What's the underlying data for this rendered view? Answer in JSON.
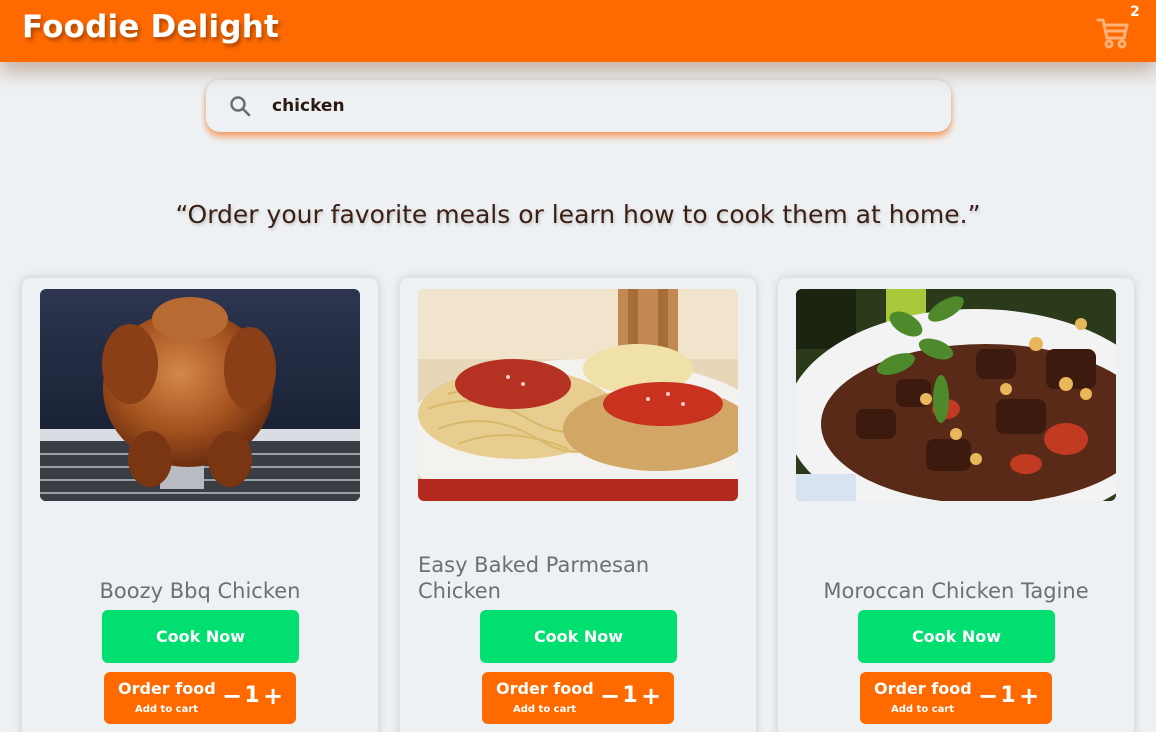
{
  "header": {
    "brand": "Foodie Delight",
    "cart_icon": "shopping-cart-icon",
    "cart_count": "2",
    "accent_color": "#ff6a00"
  },
  "search": {
    "icon": "search-icon",
    "value": "chicken"
  },
  "tagline": "“Order your favorite meals or learn how to cook them at home.”",
  "cards": [
    {
      "title": "Boozy Bbq Chicken",
      "image": "roast-chicken-on-grill",
      "cook_label": "Cook Now",
      "order_label": "Order food",
      "order_sub": "Add to cart",
      "minus": "−",
      "quantity": "1",
      "plus": "+"
    },
    {
      "title": "Easy Baked Parmesan Chicken",
      "image": "chicken-parmesan-with-spaghetti",
      "cook_label": "Cook Now",
      "order_label": "Order food",
      "order_sub": "Add to cart",
      "minus": "−",
      "quantity": "1",
      "plus": "+"
    },
    {
      "title": "Moroccan Chicken Tagine",
      "image": "chicken-tagine-with-chickpeas",
      "cook_label": "Cook Now",
      "order_label": "Order food",
      "order_sub": "Add to cart",
      "minus": "−",
      "quantity": "1",
      "plus": "+"
    }
  ],
  "colors": {
    "primary": "#ff6a00",
    "cook_button": "#00df6f",
    "background": "#eef1f3"
  }
}
